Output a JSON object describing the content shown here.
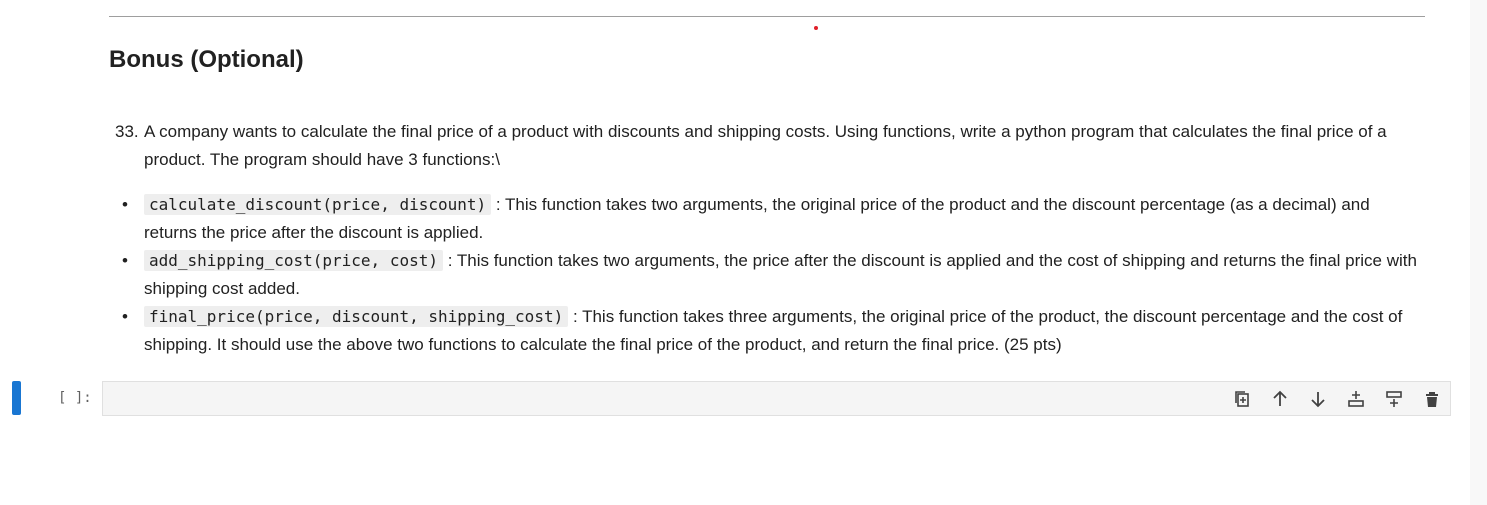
{
  "markdown": {
    "heading": "Bonus (Optional)",
    "question_number": "33.",
    "question_text": "A company wants to calculate the final price of a product with discounts and shipping costs. Using functions, write a python program that calculates the final price of a product. The program should have 3 functions:\\",
    "functions": [
      {
        "code": "calculate_discount(price, discount)",
        "description": ": This function takes two arguments, the original price of the product and the discount percentage (as a decimal) and returns the price after the discount is applied."
      },
      {
        "code": "add_shipping_cost(price, cost)",
        "description": ": This function takes two arguments, the price after the discount is applied and the cost of shipping and returns the final price with shipping cost added."
      },
      {
        "code": "final_price(price, discount, shipping_cost)",
        "description": ": This function takes three arguments, the original price of the product, the discount percentage and the cost of shipping. It should use the above two functions to calculate the final price of the product, and return the final price. (25 pts)"
      }
    ]
  },
  "code_cell": {
    "prompt": "[ ]:",
    "source": ""
  },
  "cell_toolbar": {
    "icons": [
      "duplicate-cell-icon",
      "move-up-icon",
      "move-down-icon",
      "insert-below-icon",
      "insert-above-icon",
      "delete-cell-icon"
    ]
  },
  "colors": {
    "active_cell_marker": "#1976d2",
    "code_background": "#eeeeee",
    "input_background": "#f5f5f5"
  }
}
